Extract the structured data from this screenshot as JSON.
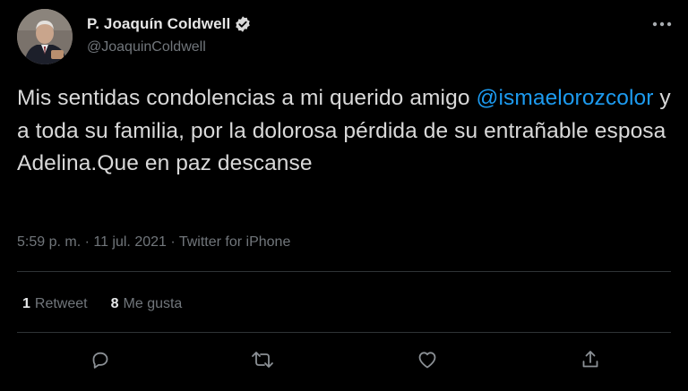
{
  "author": {
    "display_name": "P. Joaquín Coldwell",
    "handle": "@JoaquinColdwell",
    "verified": true
  },
  "tweet": {
    "text_before": "Mis sentidas condolencias a mi querido amigo ",
    "mention": "@ismaelorozcolor",
    "text_after": " y a toda su familia, por la dolorosa pérdida de su entrañable esposa Adelina.Que en paz descanse",
    "timestamp": "5:59 p. m. · 11 jul. 2021 · Twitter for iPhone"
  },
  "stats": {
    "retweets_count": "1",
    "retweets_label": "Retweet",
    "likes_count": "8",
    "likes_label": "Me gusta"
  },
  "icons": {
    "more": "more-icon",
    "reply": "reply-icon",
    "retweet": "retweet-icon",
    "like": "like-icon",
    "share": "share-icon",
    "verified": "verified-badge-icon"
  },
  "colors": {
    "background": "#000000",
    "text": "#d9d9d9",
    "secondary": "#71767b",
    "mention": "#1d9bf0",
    "divider": "#2f3336"
  }
}
